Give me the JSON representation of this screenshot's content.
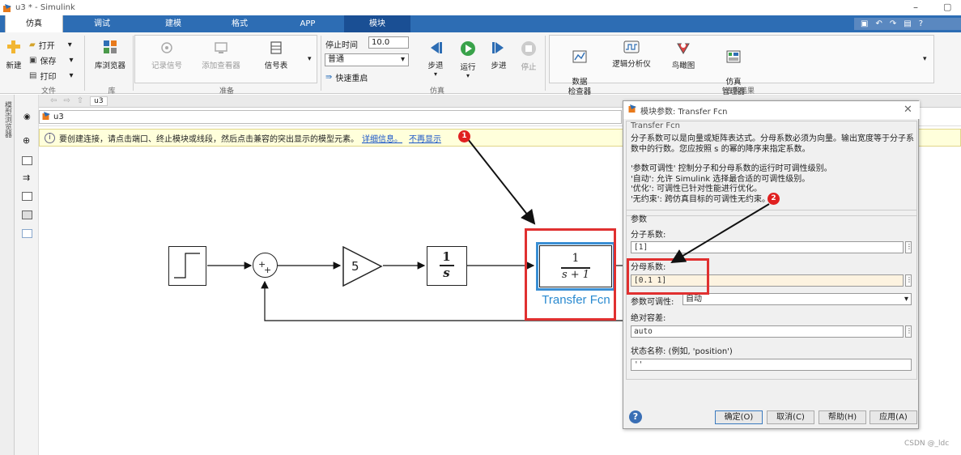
{
  "window": {
    "title": "u3 * - Simulink"
  },
  "tabs": [
    {
      "label": "仿真",
      "state": "active"
    },
    {
      "label": "调试",
      "state": "normal"
    },
    {
      "label": "建模",
      "state": "normal"
    },
    {
      "label": "格式",
      "state": "normal"
    },
    {
      "label": "APP",
      "state": "normal"
    },
    {
      "label": "模块",
      "state": "highlight"
    }
  ],
  "ribbon": {
    "file": {
      "new": "新建",
      "open": "打开",
      "save": "保存",
      "print": "打印",
      "section": "文件"
    },
    "library": {
      "browser": "库浏览器",
      "section": "库"
    },
    "prepare": {
      "log_signal": "记录信号",
      "add_viewer": "添加查看器",
      "signal_table": "信号表",
      "section": "准备"
    },
    "simulate": {
      "stop_time_label": "停止时间",
      "stop_time_value": "10.0",
      "mode": "普通",
      "fast_restart": "快速重启",
      "step_back": "步退",
      "run": "运行",
      "step_forward": "步进",
      "stop": "停止",
      "section": "仿真"
    },
    "review": {
      "data_inspector": "数据\n检查器",
      "logic_analyzer": "逻辑分析仪",
      "birds_eye": "鸟瞰图",
      "sim_manager": "仿真\n管理器",
      "section": "查看结果"
    }
  },
  "left_strip": {
    "label": "模型浏览器"
  },
  "nav": {
    "breadcrumb": "u3"
  },
  "address": {
    "model": "u3"
  },
  "infobar": {
    "message": "要创建连接，请点击端口、终止模块或线段，然后点击兼容的突出显示的模型元素。",
    "link_more": "详细信息。",
    "link_dismiss": "不再显示"
  },
  "diagram": {
    "gain_value": "5",
    "integrator_num": "1",
    "integrator_den": "s",
    "tf_num": "1",
    "tf_den": "s + 1",
    "tf_name": "Transfer Fcn",
    "sum_plus_left": "+",
    "sum_plus_bottom": "+"
  },
  "dialog": {
    "title": "模块参数: Transfer Fcn",
    "block_type": "Transfer Fcn",
    "description": "分子系数可以是向量或矩阵表达式。分母系数必须为向量。输出宽度等于分子系数中的行数。您应按照 s 的幂的降序来指定系数。",
    "tunability_lines": [
      "'参数可调性' 控制分子和分母系数的运行时可调性级别。",
      "'自动': 允许 Simulink 选择最合适的可调性级别。",
      "'优化': 可调性已针对性能进行优化。",
      "'无约束': 跨仿真目标的可调性无约束。"
    ],
    "params_header": "参数",
    "numerator_label": "分子系数:",
    "numerator_value": "[1]",
    "denominator_label": "分母系数:",
    "denominator_value": "[0.1 1]",
    "tunability_label": "参数可调性:",
    "tunability_value": "自动",
    "abs_tol_label": "绝对容差:",
    "abs_tol_value": "auto",
    "state_name_label": "状态名称: (例如, 'position')",
    "state_name_value": "''",
    "buttons": {
      "ok": "确定(O)",
      "cancel": "取消(C)",
      "help": "帮助(H)",
      "apply": "应用(A)"
    }
  },
  "annotations": {
    "badge1": "1",
    "badge2": "2"
  },
  "watermark": "CSDN @_ldc",
  "colors": {
    "tabbar": "#2d6db4",
    "highlight_tab": "#1a4f94",
    "annotation_red": "#e03030",
    "tf_border": "#3a8fd4",
    "tf_label": "#2a8ad0"
  }
}
